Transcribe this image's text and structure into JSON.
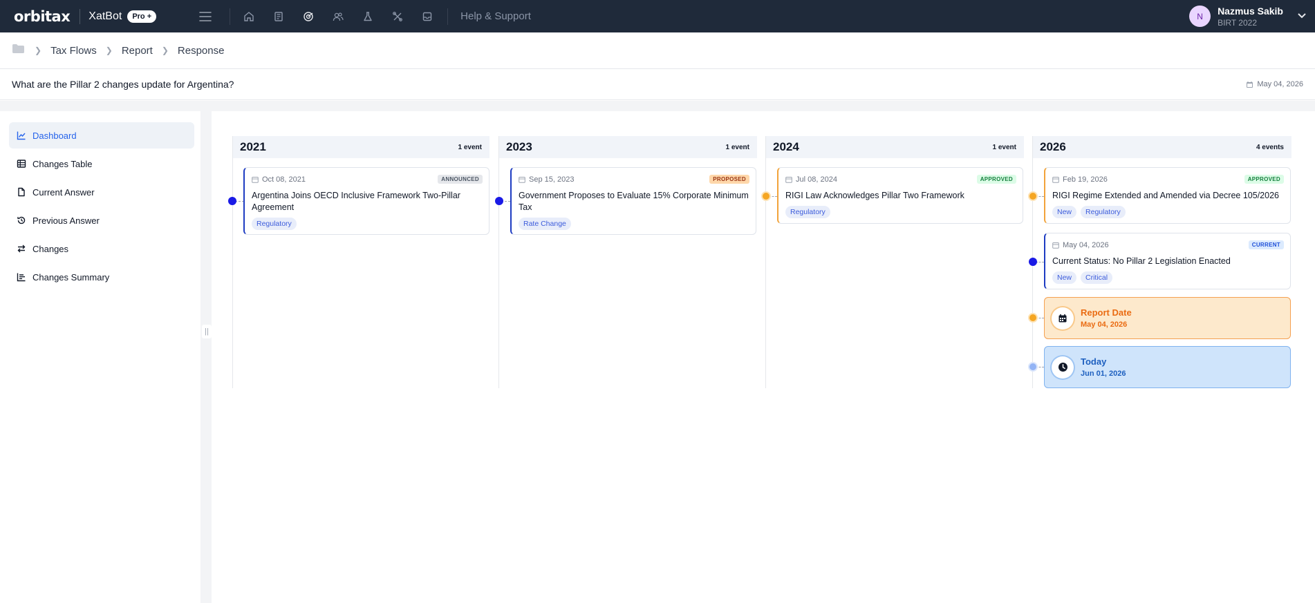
{
  "topbar": {
    "logo": "orbitax",
    "product": "XatBot",
    "plan_badge": "Pro +",
    "help_link": "Help & Support",
    "nav_icons": [
      "home-icon",
      "book-icon",
      "target-icon",
      "users-icon",
      "flask-icon",
      "tools-icon",
      "inbox-icon"
    ],
    "user": {
      "initial": "N",
      "name": "Nazmus Sakib",
      "subtitle": "BIRT 2022"
    }
  },
  "breadcrumb": {
    "items": [
      "Tax Flows",
      "Report",
      "Response"
    ]
  },
  "query": {
    "text": "What are the Pillar 2 changes update for Argentina?",
    "date": "May 04, 2026"
  },
  "sidebar": {
    "items": [
      {
        "label": "Dashboard",
        "icon": "chart-line-icon",
        "active": true
      },
      {
        "label": "Changes Table",
        "icon": "table-icon"
      },
      {
        "label": "Current Answer",
        "icon": "document-icon"
      },
      {
        "label": "Previous Answer",
        "icon": "history-icon"
      },
      {
        "label": "Changes",
        "icon": "swap-icon"
      },
      {
        "label": "Changes Summary",
        "icon": "bar-chart-icon"
      }
    ],
    "collapse_handle": "||"
  },
  "timeline": {
    "columns": [
      {
        "year": "2021",
        "count": "1 event",
        "events": [
          {
            "date": "Oct 08, 2021",
            "status": "ANNOUNCED",
            "title": "Argentina Joins OECD Inclusive Framework Two-Pillar Agreement",
            "tags": [
              "Regulatory"
            ]
          }
        ]
      },
      {
        "year": "2023",
        "count": "1 event",
        "events": [
          {
            "date": "Sep 15, 2023",
            "status": "PROPOSED",
            "title": "Government Proposes to Evaluate 15% Corporate Minimum Tax",
            "tags": [
              "Rate Change"
            ]
          }
        ]
      },
      {
        "year": "2024",
        "count": "1 event",
        "events": [
          {
            "date": "Jul 08, 2024",
            "status": "APPROVED",
            "title": "RIGI Law Acknowledges Pillar Two Framework",
            "tags": [
              "Regulatory"
            ]
          }
        ]
      },
      {
        "year": "2026",
        "count": "4 events",
        "events": [
          {
            "date": "Feb 19, 2026",
            "status": "APPROVED",
            "title": "RIGI Regime Extended and Amended via Decree 105/2026",
            "tags": [
              "New",
              "Regulatory"
            ]
          },
          {
            "date": "May 04, 2026",
            "status": "CURRENT",
            "title": "Current Status: No Pillar 2 Legislation Enacted",
            "tags": [
              "New",
              "Critical"
            ]
          }
        ],
        "report_date": {
          "label": "Report Date",
          "date": "May 04, 2026"
        },
        "today": {
          "label": "Today",
          "date": "Jun 01, 2026"
        }
      }
    ]
  }
}
